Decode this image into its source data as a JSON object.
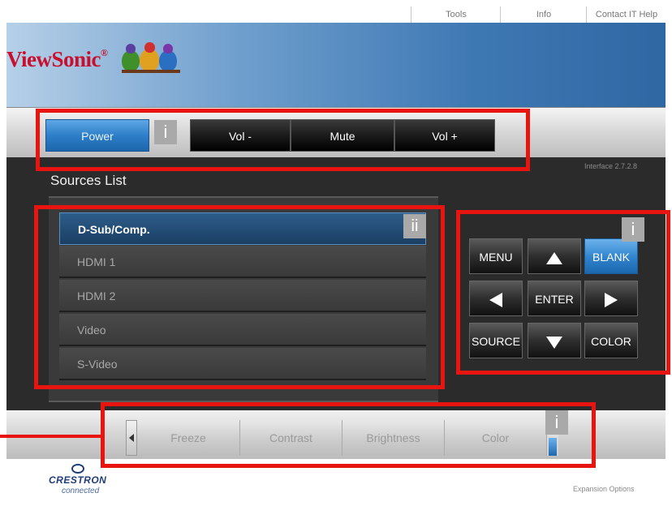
{
  "top_links": [
    "Tools",
    "Info",
    "Contact IT Help"
  ],
  "brand": {
    "logo_text": "ViewSonic",
    "registered": "®"
  },
  "control_bar": {
    "power": "Power",
    "vol_down": "Vol -",
    "mute": "Mute",
    "vol_up": "Vol +"
  },
  "interface_version": "Interface 2.7.2.8",
  "sources": {
    "title": "Sources List",
    "items": [
      "D-Sub/Comp.",
      "HDMI 1",
      "HDMI 2",
      "Video",
      "S-Video"
    ],
    "selected": "D-Sub/Comp."
  },
  "keypad": {
    "menu": "MENU",
    "blank": "BLANK",
    "enter": "ENTER",
    "source": "SOURCE",
    "color": "COLOR"
  },
  "bottom_bar": {
    "items": [
      "Freeze",
      "Contrast",
      "Brightness",
      "Color"
    ]
  },
  "footer": {
    "crestron": "CRESTRON",
    "connected": "connected",
    "expansion": "Expansion Options"
  },
  "annotations": {
    "marker_i": "i",
    "marker_ii": "ii",
    "highlight_color": "#e8140f"
  }
}
